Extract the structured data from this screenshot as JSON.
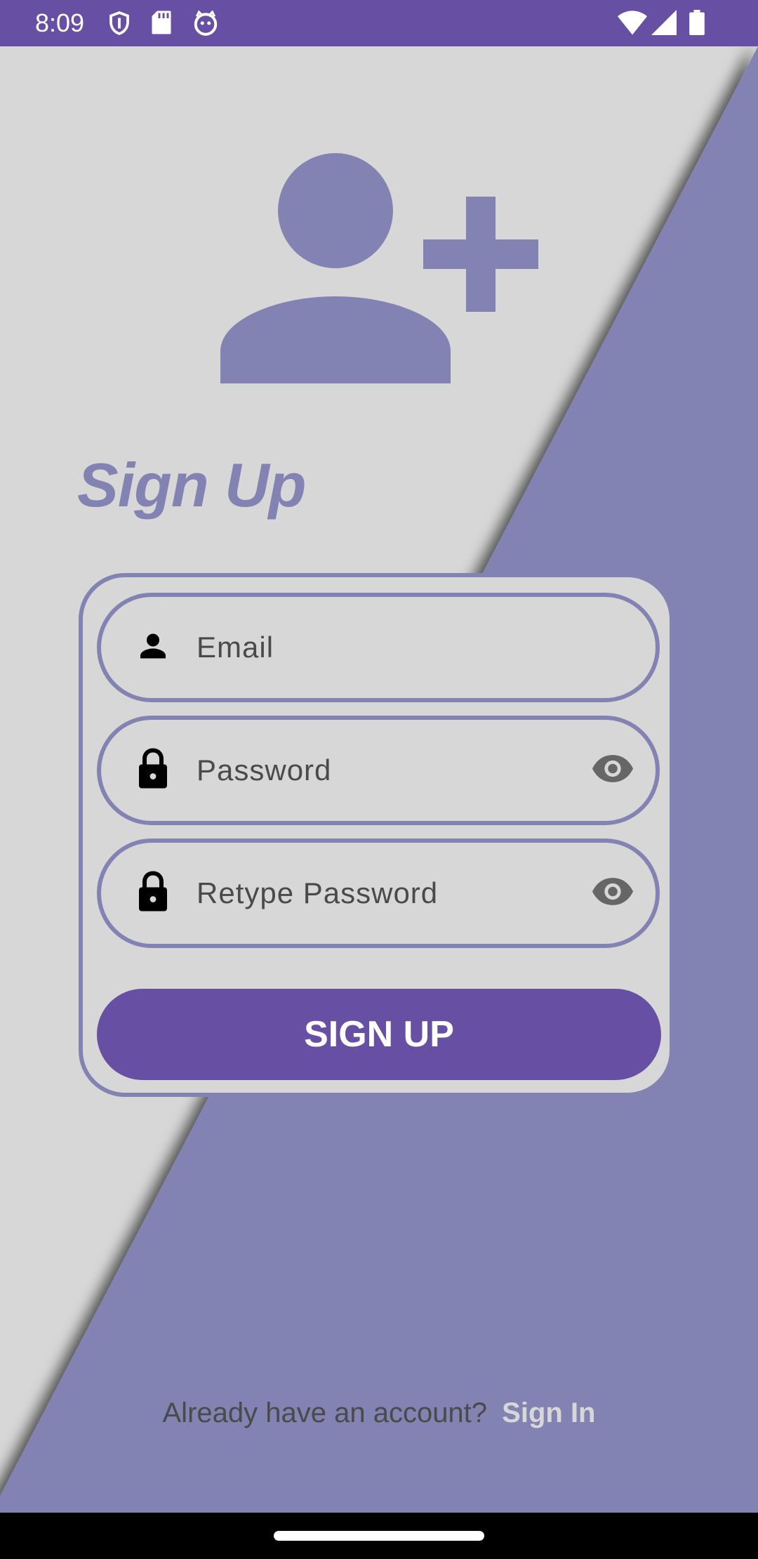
{
  "status_bar": {
    "time": "8:09",
    "left_icons": [
      "shield-icon",
      "sd-card-icon",
      "cat-icon"
    ],
    "right_icons": [
      "wifi-icon",
      "cell-signal-icon",
      "battery-icon"
    ]
  },
  "colors": {
    "primary": "#6750a4",
    "accent": "#8383b3",
    "background": "#d7d7d7"
  },
  "hero_icon": "add-person-icon",
  "title": "Sign Up",
  "form": {
    "email_label": "Email",
    "password_label": "Password",
    "retype_password_label": "Retype Password",
    "submit_label": "SIGN UP"
  },
  "footer": {
    "prompt": "Already have an account?",
    "link_label": "Sign In"
  }
}
